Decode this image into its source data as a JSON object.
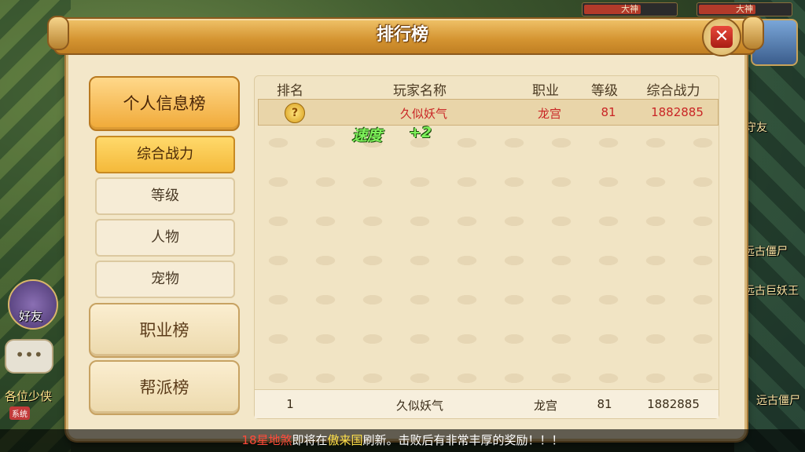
{
  "game_hud": {
    "top_bars": [
      "大神",
      "大神"
    ],
    "friends_label": "好友",
    "chat_icon": "chat-bubble-icon",
    "chat_preview": "各位少侠",
    "chat_badge": "系统",
    "right_labels": [
      "守友",
      "远古僵尸",
      "远古巨妖王",
      "远古僵尸"
    ]
  },
  "window": {
    "title": "排行榜",
    "close_icon": "close-icon"
  },
  "nav": {
    "main": [
      {
        "label": "个人信息榜",
        "active": true
      },
      {
        "label": "职业榜",
        "active": false
      },
      {
        "label": "帮派榜",
        "active": false
      }
    ],
    "sub": [
      {
        "label": "综合战力",
        "active": true
      },
      {
        "label": "等级",
        "active": false
      },
      {
        "label": "人物",
        "active": false
      },
      {
        "label": "宠物",
        "active": false
      }
    ]
  },
  "table": {
    "headers": [
      "排名",
      "玩家名称",
      "职业",
      "等级",
      "综合战力"
    ],
    "rows": [
      {
        "rank_icon": "question-medal-icon",
        "name": "久似妖气",
        "class": "龙宫",
        "level": "81",
        "power": "1882885"
      }
    ],
    "self_row": {
      "rank": "1",
      "name": "久似妖气",
      "class": "龙宫",
      "level": "81",
      "power": "1882885"
    }
  },
  "buff": {
    "label": "速度",
    "value": "+2"
  },
  "announcement": {
    "part1": "18星地煞",
    "part2": "即将在",
    "part3": "傲来国",
    "part4": "刷新。击败后有非常丰厚的奖励！！！"
  },
  "colors": {
    "title_bar": "#d49431",
    "panel": "#f3e7c9",
    "highlight_text": "#c92525",
    "buff_text": "#7df05a"
  }
}
